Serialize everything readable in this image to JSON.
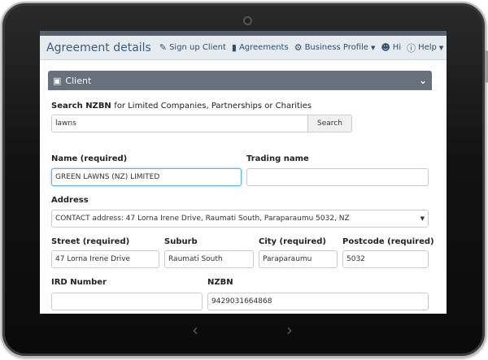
{
  "header": {
    "title": "Agreement details",
    "nav": [
      {
        "icon": "edit-icon",
        "label": "Sign up Client"
      },
      {
        "icon": "book-icon",
        "label": "Agreements"
      },
      {
        "icon": "cogs-icon",
        "label": "Business Profile"
      },
      {
        "icon": "user-icon",
        "label": "Hi"
      },
      {
        "icon": "help-icon",
        "label": "Help"
      }
    ]
  },
  "section": {
    "title": "Client"
  },
  "search": {
    "label_bold": "Search NZBN",
    "label_rest": "for Limited Companies, Partnerships or Charities",
    "value": "lawns",
    "button": "Search"
  },
  "fields": {
    "name": {
      "label": "Name (required)",
      "value": "GREEN LAWNS (NZ) LIMITED"
    },
    "trading_name": {
      "label": "Trading name",
      "value": ""
    },
    "address": {
      "label": "Address",
      "value": "CONTACT address: 47 Lorna Irene Drive, Raumati South, Paraparaumu 5032, NZ"
    },
    "street": {
      "label": "Street (required)",
      "value": "47 Lorna Irene Drive"
    },
    "suburb": {
      "label": "Suburb",
      "value": "Raumati South"
    },
    "city": {
      "label": "City (required)",
      "value": "Paraparaumu"
    },
    "postcode": {
      "label": "Postcode (required)",
      "value": "5032"
    },
    "ird": {
      "label": "IRD Number",
      "value": ""
    },
    "nzbn": {
      "label": "NZBN",
      "value": "9429031664868"
    }
  }
}
